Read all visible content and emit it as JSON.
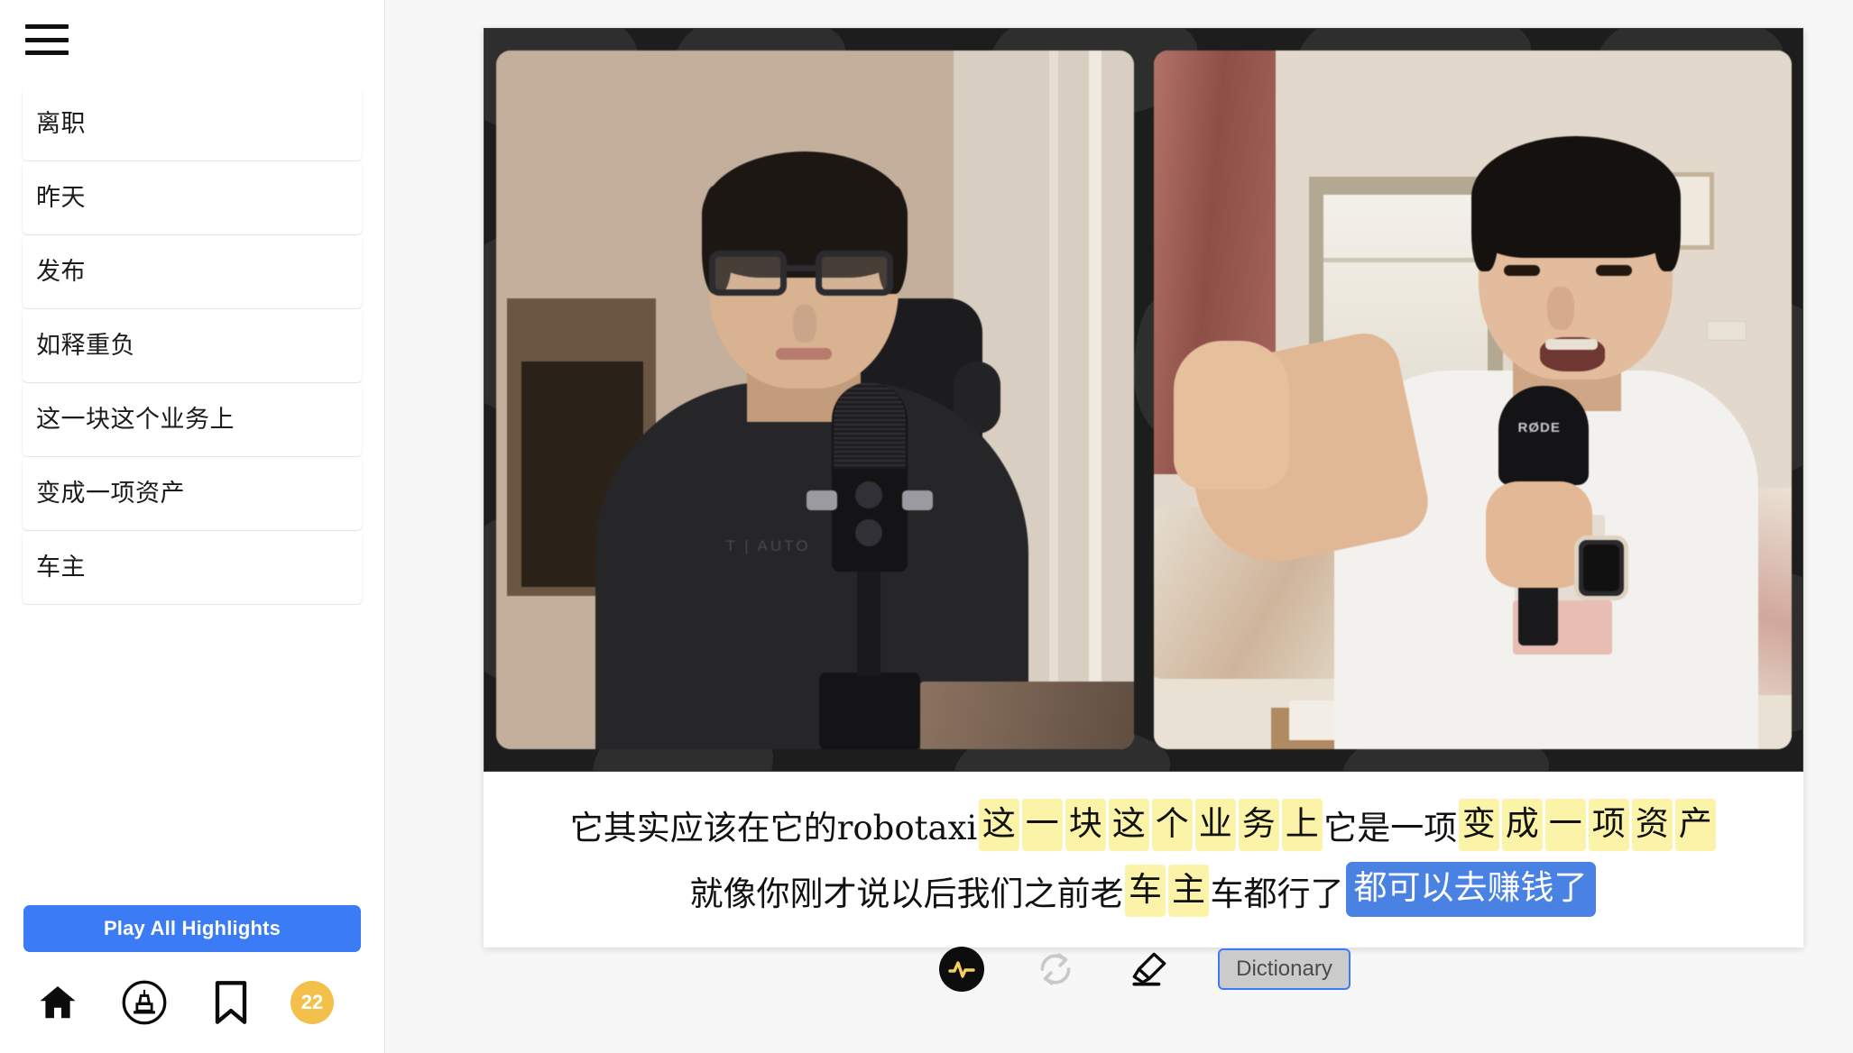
{
  "app": {
    "background_color": "#f7f7f7",
    "accent_blue": "#3b7bf6",
    "highlight_yellow": "#fbf4a8",
    "highlight_blue": "#4a82e4",
    "badge_yellow": "#f2c04b"
  },
  "sidebar": {
    "menu_button": "menu",
    "highlights": [
      {
        "label": "离职"
      },
      {
        "label": "昨天"
      },
      {
        "label": "发布"
      },
      {
        "label": "如释重负"
      },
      {
        "label": "这一块这个业务上"
      },
      {
        "label": "变成一项资产"
      },
      {
        "label": "车主"
      }
    ],
    "play_all_label": "Play All Highlights",
    "nav": {
      "home_icon": "home-icon",
      "highlighter_icon": "highlighter-circle-icon",
      "bookmark_icon": "bookmark-icon",
      "badge_count": "22"
    }
  },
  "player": {
    "video": {
      "left_pane": "speaker-left-video",
      "right_pane": "speaker-right-video"
    },
    "subtitles": {
      "line1": [
        {
          "text": "它其实应该在它的",
          "style": "plain"
        },
        {
          "text": "robotaxi",
          "style": "latin"
        },
        {
          "text": "这",
          "style": "yellow"
        },
        {
          "text": "一",
          "style": "yellow"
        },
        {
          "text": "块",
          "style": "yellow"
        },
        {
          "text": "这",
          "style": "yellow"
        },
        {
          "text": "个",
          "style": "yellow"
        },
        {
          "text": "业",
          "style": "yellow"
        },
        {
          "text": "务",
          "style": "yellow"
        },
        {
          "text": "上",
          "style": "yellow"
        },
        {
          "text": " 它是一项",
          "style": "plain"
        },
        {
          "text": "变",
          "style": "yellow"
        },
        {
          "text": "成",
          "style": "yellow"
        },
        {
          "text": "一",
          "style": "yellow"
        },
        {
          "text": "项",
          "style": "yellow"
        },
        {
          "text": "资",
          "style": "yellow"
        },
        {
          "text": "产",
          "style": "yellow"
        }
      ],
      "line2": [
        {
          "text": "就像你刚才说以后我们之前老",
          "style": "plain"
        },
        {
          "text": "车",
          "style": "yellow"
        },
        {
          "text": "主",
          "style": "yellow"
        },
        {
          "text": "车都行了",
          "style": "plain"
        },
        {
          "text": "都可以去赚钱了",
          "style": "blue"
        }
      ]
    }
  },
  "toolbar": {
    "waveform_icon": "waveform-activity-icon",
    "loop_icon": "loop-repeat-icon",
    "highlighter_icon": "highlighter-marker-icon",
    "dictionary_label": "Dictionary"
  }
}
